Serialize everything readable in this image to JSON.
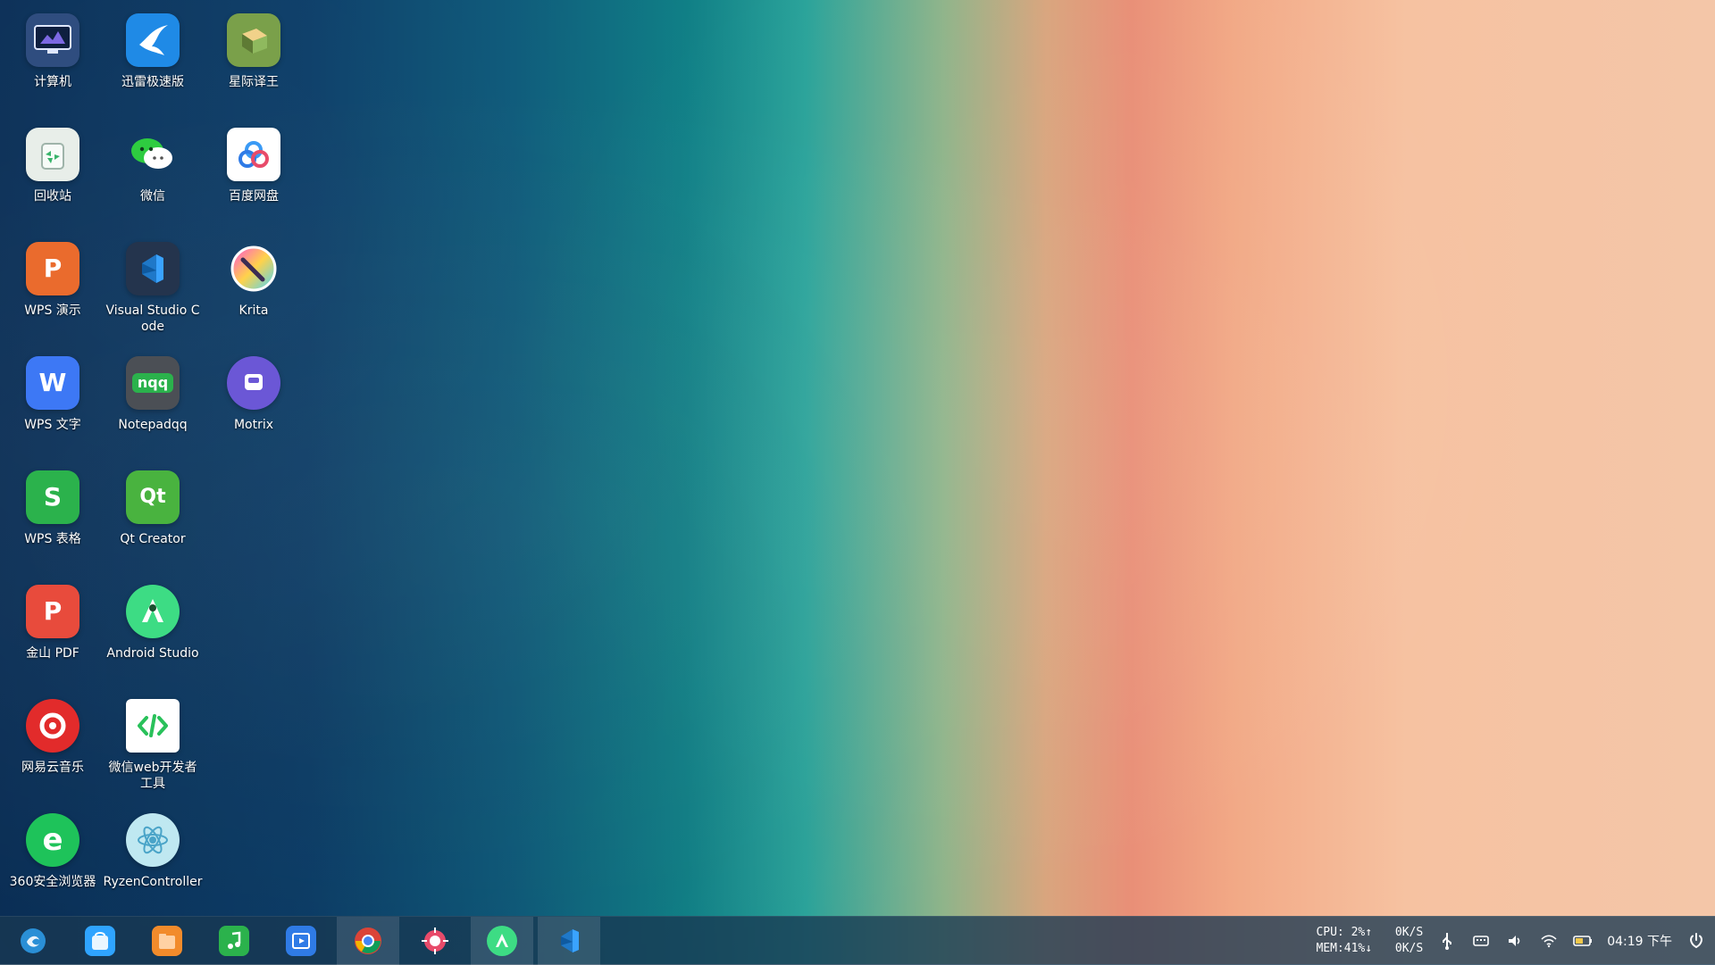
{
  "desktop": {
    "icons": [
      {
        "label": "计算机",
        "icon": "computer-icon"
      },
      {
        "label": "迅雷极速版",
        "icon": "thunder-icon"
      },
      {
        "label": "星际译王",
        "icon": "stardict-icon"
      },
      {
        "label": "回收站",
        "icon": "trash-icon"
      },
      {
        "label": "微信",
        "icon": "wechat-icon"
      },
      {
        "label": "百度网盘",
        "icon": "baidu-netdisk-icon"
      },
      {
        "label": "WPS 演示",
        "icon": "wps-presentation-icon"
      },
      {
        "label": "Visual Studio Code",
        "icon": "vscode-icon"
      },
      {
        "label": "Krita",
        "icon": "krita-icon"
      },
      {
        "label": "WPS 文字",
        "icon": "wps-writer-icon"
      },
      {
        "label": "Notepadqq",
        "icon": "notepadqq-icon",
        "icon_text": "nqq"
      },
      {
        "label": "Motrix",
        "icon": "motrix-icon"
      },
      {
        "label": "WPS 表格",
        "icon": "wps-spreadsheet-icon"
      },
      {
        "label": "Qt Creator",
        "icon": "qt-creator-icon",
        "icon_text": "Qt"
      },
      {
        "label": "金山 PDF",
        "icon": "kingsoft-pdf-icon"
      },
      {
        "label": "Android Studio",
        "icon": "android-studio-icon"
      },
      {
        "label": "网易云音乐",
        "icon": "netease-music-icon"
      },
      {
        "label": "微信web开发者工具",
        "icon": "wechat-devtools-icon"
      },
      {
        "label": "360安全浏览器",
        "icon": "360-browser-icon"
      },
      {
        "label": "RyzenController",
        "icon": "ryzen-controller-icon"
      }
    ]
  },
  "taskbar": {
    "apps": [
      {
        "name": "launcher-icon",
        "active": false
      },
      {
        "name": "app-store-icon",
        "active": false
      },
      {
        "name": "file-manager-icon",
        "active": false
      },
      {
        "name": "music-player-icon",
        "active": false
      },
      {
        "name": "video-player-icon",
        "active": false
      },
      {
        "name": "chrome-icon",
        "active": true
      },
      {
        "name": "settings-gear-icon",
        "active": false
      },
      {
        "name": "android-studio-icon",
        "active": true
      },
      {
        "name": "vscode-icon",
        "active": true
      }
    ],
    "monitor": {
      "cpu": "CPU: 2%↑",
      "mem": "MEM:41%↓",
      "up": "0K/S",
      "down": "0K/S"
    },
    "clock": "04:19 下午"
  },
  "colors": {
    "taskbar_bg": "#183852",
    "accent_green": "#29c15a",
    "accent_blue": "#2f7be6",
    "wps_red": "#e84b3c",
    "wps_blue": "#3d78f5",
    "wps_green": "#2bb24c"
  }
}
